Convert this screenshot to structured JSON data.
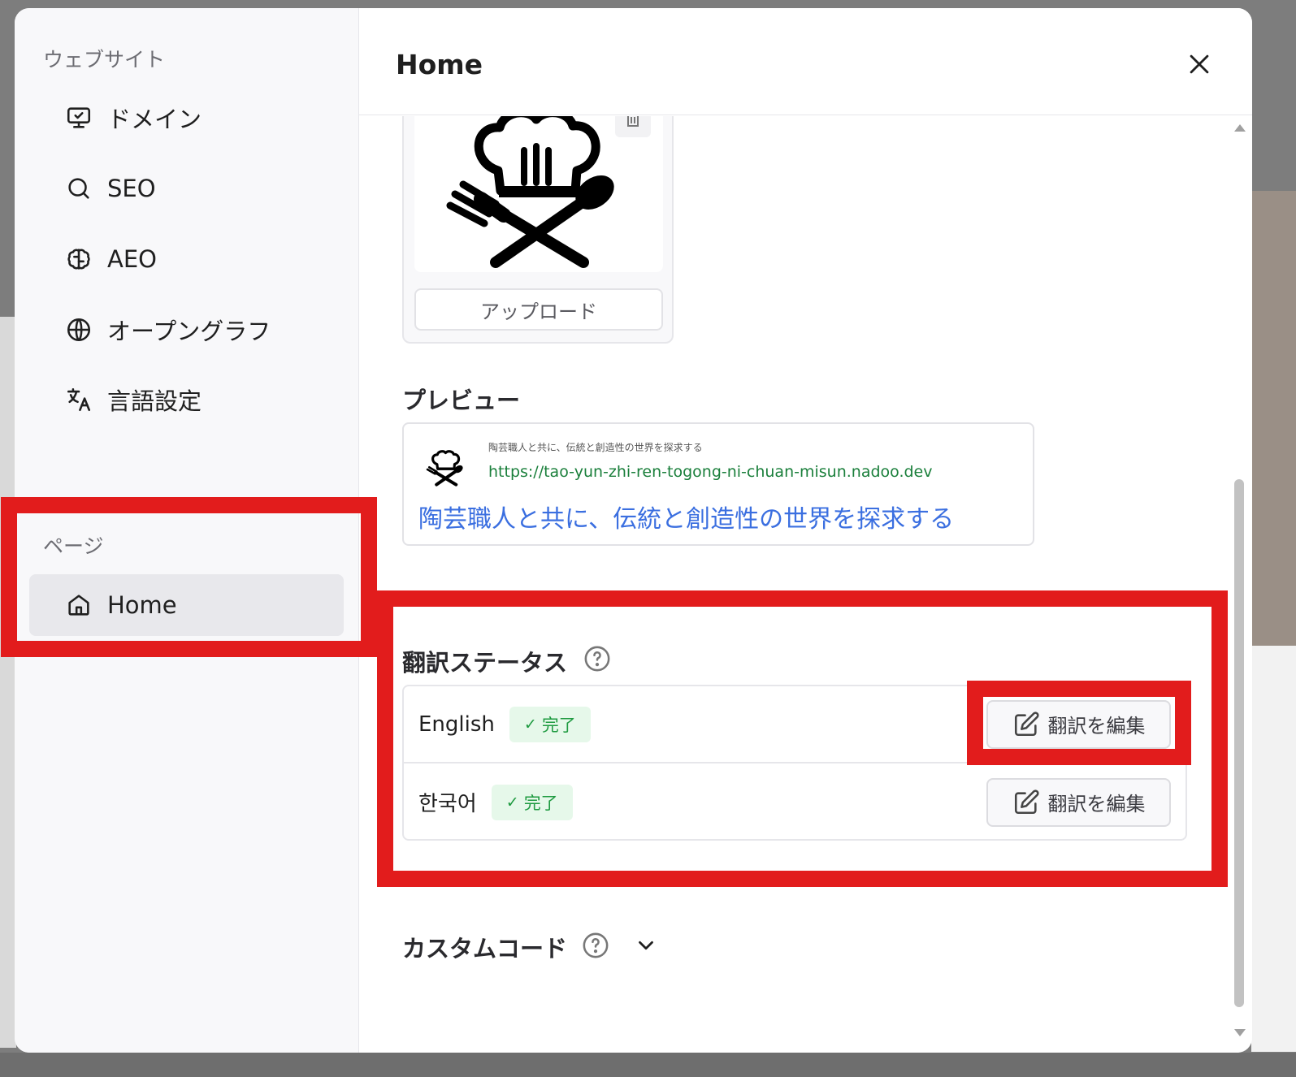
{
  "sidebar": {
    "website_label": "ウェブサイト",
    "items": [
      {
        "label": "ドメイン",
        "icon": "monitor-icon"
      },
      {
        "label": "SEO",
        "icon": "search-icon"
      },
      {
        "label": "AEO",
        "icon": "brain-icon"
      },
      {
        "label": "オープングラフ",
        "icon": "globe-icon"
      },
      {
        "label": "言語設定",
        "icon": "translate-icon"
      }
    ],
    "pages_label": "ページ",
    "pages": [
      {
        "label": "Home",
        "icon": "home-icon",
        "active": true
      }
    ]
  },
  "header": {
    "title": "Home"
  },
  "image_upload": {
    "upload_label": "アップロード"
  },
  "preview": {
    "section_title": "プレビュー",
    "small_title": "陶芸職人と共に、伝統と創造性の世界を探求する",
    "url": "https://tao-yun-zhi-ren-togong-ni-chuan-misun.nadoo.dev",
    "title": "陶芸職人と共に、伝統と創造性の世界を探求する"
  },
  "translation_status": {
    "section_title": "翻訳ステータス",
    "rows": [
      {
        "language": "English",
        "status": "完了",
        "edit_label": "翻訳を編集"
      },
      {
        "language": "한국어",
        "status": "完了",
        "edit_label": "翻訳を編集"
      }
    ]
  },
  "custom_code": {
    "section_title": "カスタムコード"
  },
  "colors": {
    "highlight": "#e21c1c",
    "status_green": "#1e9a40",
    "link_blue": "#3b6fe0",
    "url_green": "#1a7f3b"
  }
}
